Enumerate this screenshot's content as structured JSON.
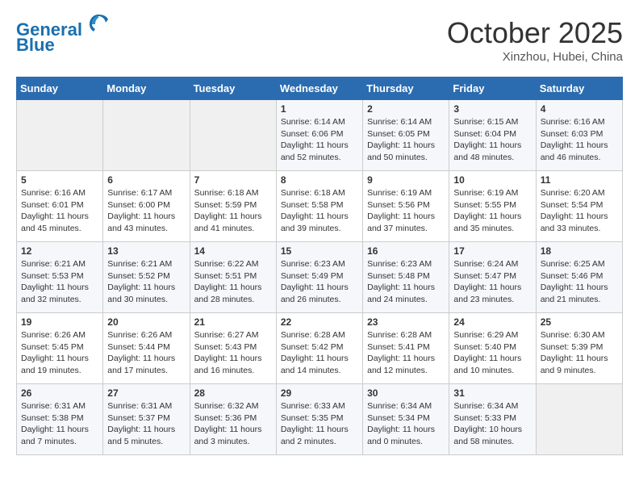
{
  "header": {
    "logo_line1": "General",
    "logo_line2": "Blue",
    "month": "October 2025",
    "location": "Xinzhou, Hubei, China"
  },
  "weekdays": [
    "Sunday",
    "Monday",
    "Tuesday",
    "Wednesday",
    "Thursday",
    "Friday",
    "Saturday"
  ],
  "weeks": [
    [
      {
        "day": "",
        "empty": true
      },
      {
        "day": "",
        "empty": true
      },
      {
        "day": "",
        "empty": true
      },
      {
        "day": "1",
        "sunrise": "6:14 AM",
        "sunset": "6:06 PM",
        "daylight": "11 hours and 52 minutes."
      },
      {
        "day": "2",
        "sunrise": "6:14 AM",
        "sunset": "6:05 PM",
        "daylight": "11 hours and 50 minutes."
      },
      {
        "day": "3",
        "sunrise": "6:15 AM",
        "sunset": "6:04 PM",
        "daylight": "11 hours and 48 minutes."
      },
      {
        "day": "4",
        "sunrise": "6:16 AM",
        "sunset": "6:03 PM",
        "daylight": "11 hours and 46 minutes."
      }
    ],
    [
      {
        "day": "5",
        "sunrise": "6:16 AM",
        "sunset": "6:01 PM",
        "daylight": "11 hours and 45 minutes."
      },
      {
        "day": "6",
        "sunrise": "6:17 AM",
        "sunset": "6:00 PM",
        "daylight": "11 hours and 43 minutes."
      },
      {
        "day": "7",
        "sunrise": "6:18 AM",
        "sunset": "5:59 PM",
        "daylight": "11 hours and 41 minutes."
      },
      {
        "day": "8",
        "sunrise": "6:18 AM",
        "sunset": "5:58 PM",
        "daylight": "11 hours and 39 minutes."
      },
      {
        "day": "9",
        "sunrise": "6:19 AM",
        "sunset": "5:56 PM",
        "daylight": "11 hours and 37 minutes."
      },
      {
        "day": "10",
        "sunrise": "6:19 AM",
        "sunset": "5:55 PM",
        "daylight": "11 hours and 35 minutes."
      },
      {
        "day": "11",
        "sunrise": "6:20 AM",
        "sunset": "5:54 PM",
        "daylight": "11 hours and 33 minutes."
      }
    ],
    [
      {
        "day": "12",
        "sunrise": "6:21 AM",
        "sunset": "5:53 PM",
        "daylight": "11 hours and 32 minutes."
      },
      {
        "day": "13",
        "sunrise": "6:21 AM",
        "sunset": "5:52 PM",
        "daylight": "11 hours and 30 minutes."
      },
      {
        "day": "14",
        "sunrise": "6:22 AM",
        "sunset": "5:51 PM",
        "daylight": "11 hours and 28 minutes."
      },
      {
        "day": "15",
        "sunrise": "6:23 AM",
        "sunset": "5:49 PM",
        "daylight": "11 hours and 26 minutes."
      },
      {
        "day": "16",
        "sunrise": "6:23 AM",
        "sunset": "5:48 PM",
        "daylight": "11 hours and 24 minutes."
      },
      {
        "day": "17",
        "sunrise": "6:24 AM",
        "sunset": "5:47 PM",
        "daylight": "11 hours and 23 minutes."
      },
      {
        "day": "18",
        "sunrise": "6:25 AM",
        "sunset": "5:46 PM",
        "daylight": "11 hours and 21 minutes."
      }
    ],
    [
      {
        "day": "19",
        "sunrise": "6:26 AM",
        "sunset": "5:45 PM",
        "daylight": "11 hours and 19 minutes."
      },
      {
        "day": "20",
        "sunrise": "6:26 AM",
        "sunset": "5:44 PM",
        "daylight": "11 hours and 17 minutes."
      },
      {
        "day": "21",
        "sunrise": "6:27 AM",
        "sunset": "5:43 PM",
        "daylight": "11 hours and 16 minutes."
      },
      {
        "day": "22",
        "sunrise": "6:28 AM",
        "sunset": "5:42 PM",
        "daylight": "11 hours and 14 minutes."
      },
      {
        "day": "23",
        "sunrise": "6:28 AM",
        "sunset": "5:41 PM",
        "daylight": "11 hours and 12 minutes."
      },
      {
        "day": "24",
        "sunrise": "6:29 AM",
        "sunset": "5:40 PM",
        "daylight": "11 hours and 10 minutes."
      },
      {
        "day": "25",
        "sunrise": "6:30 AM",
        "sunset": "5:39 PM",
        "daylight": "11 hours and 9 minutes."
      }
    ],
    [
      {
        "day": "26",
        "sunrise": "6:31 AM",
        "sunset": "5:38 PM",
        "daylight": "11 hours and 7 minutes."
      },
      {
        "day": "27",
        "sunrise": "6:31 AM",
        "sunset": "5:37 PM",
        "daylight": "11 hours and 5 minutes."
      },
      {
        "day": "28",
        "sunrise": "6:32 AM",
        "sunset": "5:36 PM",
        "daylight": "11 hours and 3 minutes."
      },
      {
        "day": "29",
        "sunrise": "6:33 AM",
        "sunset": "5:35 PM",
        "daylight": "11 hours and 2 minutes."
      },
      {
        "day": "30",
        "sunrise": "6:34 AM",
        "sunset": "5:34 PM",
        "daylight": "11 hours and 0 minutes."
      },
      {
        "day": "31",
        "sunrise": "6:34 AM",
        "sunset": "5:33 PM",
        "daylight": "10 hours and 58 minutes."
      },
      {
        "day": "",
        "empty": true
      }
    ]
  ],
  "labels": {
    "sunrise": "Sunrise:",
    "sunset": "Sunset:",
    "daylight": "Daylight:"
  }
}
